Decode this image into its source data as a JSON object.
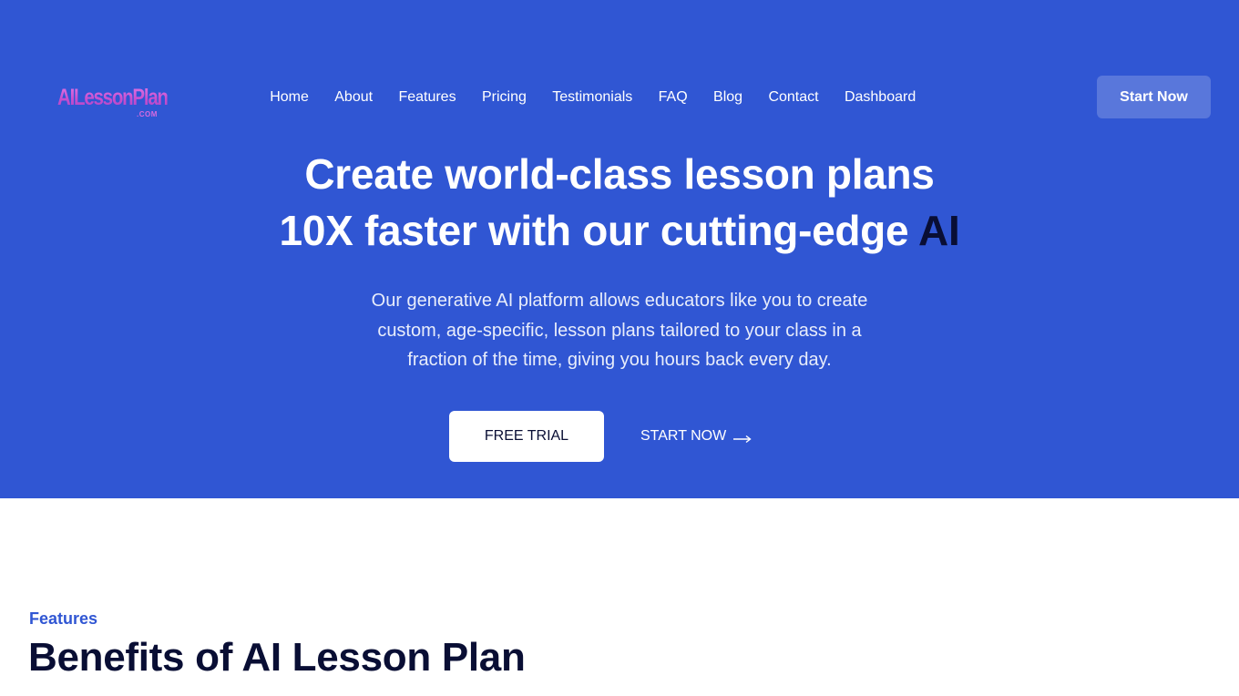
{
  "brand": {
    "logo_text": "AILessonPlan",
    "logo_suffix": ".COM"
  },
  "nav": {
    "items": [
      {
        "label": "Home"
      },
      {
        "label": "About"
      },
      {
        "label": "Features"
      },
      {
        "label": "Pricing"
      },
      {
        "label": "Testimonials"
      },
      {
        "label": "FAQ"
      },
      {
        "label": "Blog"
      },
      {
        "label": "Contact"
      },
      {
        "label": "Dashboard"
      }
    ],
    "cta_label": "Start Now"
  },
  "hero": {
    "title_line1": "Create world-class lesson plans",
    "title_line2": "10X faster with our cutting-edge",
    "title_accent": "AI",
    "description": "Our generative AI platform allows educators like you to create custom, age-specific, lesson plans tailored to your class in a fraction of the time, giving you hours back every day.",
    "primary_button": "FREE TRIAL",
    "secondary_button": "START NOW",
    "secondary_icon": "arrow-right-icon"
  },
  "features": {
    "label": "Features",
    "title": "Benefits of AI Lesson Plan"
  },
  "colors": {
    "primary": "#3056d3",
    "dark": "#090e34",
    "white": "#ffffff",
    "logo_gradient_start": "#e27ae8",
    "logo_gradient_end": "#a945c9"
  }
}
